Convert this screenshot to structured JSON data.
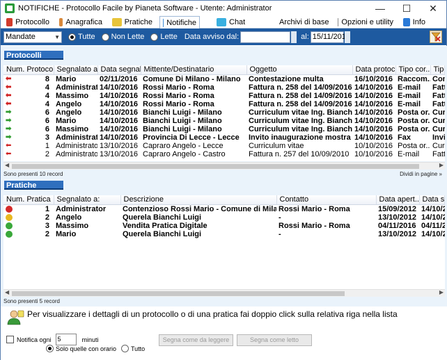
{
  "window": {
    "title": "NOTIFICHE - Protocollo Facile by Pianeta Software - Utente: Administrator"
  },
  "tabs": [
    {
      "label": "Protocollo",
      "icon": "protocollo-icon",
      "color": "#d23b2b"
    },
    {
      "label": "Anagrafica",
      "icon": "anagrafica-icon",
      "color": "#d8883a"
    },
    {
      "label": "Pratiche",
      "icon": "pratiche-icon",
      "color": "#e8c43a"
    },
    {
      "label": "Notifiche",
      "icon": "notifiche-icon",
      "color": "#3a8ad8"
    },
    {
      "label": "Chat",
      "icon": "chat-icon",
      "color": "#3ab0e0"
    },
    {
      "label": "Archivi di base",
      "icon": "archivi-icon",
      "color": "#3a6fd8"
    },
    {
      "label": "Opzioni e utility",
      "icon": "opzioni-icon",
      "color": "#8a8a8a"
    },
    {
      "label": "Info",
      "icon": "info-icon",
      "color": "#2a7ad8"
    }
  ],
  "filter": {
    "type_value": "Mandate",
    "radio_all": "Tutte",
    "radio_unread": "Non Lette",
    "radio_read": "Lette",
    "date_from_label": "Data avviso dal",
    "date_from_value": "",
    "date_to_label": "al",
    "date_to_value": "15/11/2016"
  },
  "protocolli": {
    "title": "Protocolli",
    "columns": [
      "Num. Protoco...",
      "Segnalato a:",
      "Data segnal...",
      "Mittente/Destinatario",
      "Oggetto",
      "Data protoc...",
      "Tipo cor...",
      "Tipo"
    ],
    "rows": [
      {
        "dir": "in",
        "num": "8",
        "segn": "Mario",
        "data": "02/11/2016",
        "mitt": "Comune Di Milano - Milano",
        "ogg": "Contestazione multa",
        "dprot": "16/10/2016",
        "tipo": "Raccom...",
        "tipo2": "Cont",
        "bold": true
      },
      {
        "dir": "in",
        "num": "4",
        "segn": "Administrat...",
        "data": "14/10/2016",
        "mitt": "Rossi Mario - Roma",
        "ogg": "Fattura n. 258 del 14/09/2016",
        "dprot": "14/10/2016",
        "tipo": "E-mail",
        "tipo2": "Fatt",
        "bold": true
      },
      {
        "dir": "in",
        "num": "4",
        "segn": "Massimo",
        "data": "14/10/2016",
        "mitt": "Rossi Mario - Roma",
        "ogg": "Fattura n. 258 del 14/09/2016",
        "dprot": "14/10/2016",
        "tipo": "E-mail",
        "tipo2": "Fatt",
        "bold": true
      },
      {
        "dir": "in",
        "num": "4",
        "segn": "Angelo",
        "data": "14/10/2016",
        "mitt": "Rossi Mario - Roma",
        "ogg": "Fattura n. 258 del 14/09/2016",
        "dprot": "14/10/2016",
        "tipo": "E-mail",
        "tipo2": "Fatt",
        "bold": true
      },
      {
        "dir": "out",
        "num": "6",
        "segn": "Angelo",
        "data": "14/10/2016",
        "mitt": "Bianchi Luigi - Milano",
        "ogg": "Curriculum vitae Ing. Bianchi Luigi",
        "dprot": "14/10/2016",
        "tipo": "Posta or...",
        "tipo2": "Curri",
        "bold": true
      },
      {
        "dir": "out",
        "num": "6",
        "segn": "Mario",
        "data": "14/10/2016",
        "mitt": "Bianchi Luigi - Milano",
        "ogg": "Curriculum vitae Ing. Bianchi Luigi",
        "dprot": "14/10/2016",
        "tipo": "Posta or...",
        "tipo2": "Curri",
        "bold": true
      },
      {
        "dir": "out",
        "num": "6",
        "segn": "Massimo",
        "data": "14/10/2016",
        "mitt": "Bianchi Luigi - Milano",
        "ogg": "Curriculum vitae Ing. Bianchi Luigi",
        "dprot": "14/10/2016",
        "tipo": "Posta or...",
        "tipo2": "Curri",
        "bold": true
      },
      {
        "dir": "out",
        "num": "3",
        "segn": "Administrat...",
        "data": "14/10/2016",
        "mitt": "Provincia Di Lecce - Lecce",
        "ogg": "Invito inaugurazione mostra",
        "dprot": "14/10/2016",
        "tipo": "Fax",
        "tipo2": "Invit",
        "bold": true
      },
      {
        "dir": "in",
        "num": "1",
        "segn": "Administrator",
        "data": "13/10/2016",
        "mitt": "Capraro Angelo - Lecce",
        "ogg": "Curriculum vitae",
        "dprot": "10/10/2016",
        "tipo": "Posta or...",
        "tipo2": "Curri",
        "bold": false
      },
      {
        "dir": "in",
        "num": "2",
        "segn": "Administrator",
        "data": "13/10/2016",
        "mitt": "Capraro Angelo - Castro",
        "ogg": "Fattura n. 257 del 10/09/2010",
        "dprot": "10/10/2016",
        "tipo": "E-mail",
        "tipo2": "Fatt",
        "bold": false
      }
    ],
    "count_text": "Sono presenti 10 record",
    "split_link": "Dividi in pagine »"
  },
  "pratiche": {
    "title": "Pratiche",
    "columns": [
      "Num. Pratica",
      "Segnalato a:",
      "Descrizione",
      "Contatto",
      "Data apert...",
      "Data segn"
    ],
    "rows": [
      {
        "status": "#d42a2a",
        "num": "1",
        "segn": "Administrator",
        "desc": "Contenzioso Rossi Mario - Comune di Milano",
        "cont": "Rossi Mario - Roma",
        "dap": "15/09/2012",
        "dseg": "14/10/201"
      },
      {
        "status": "#e8b820",
        "num": "2",
        "segn": "Angelo",
        "desc": "Querela Bianchi Luigi",
        "cont": "-",
        "dap": "13/10/2012",
        "dseg": "14/10/201"
      },
      {
        "status": "#3aa83a",
        "num": "3",
        "segn": "Massimo",
        "desc": "Vendita Pratica Digitale",
        "cont": "Rossi Mario - Roma",
        "dap": "04/11/2016",
        "dseg": "04/11/201"
      },
      {
        "status": "#3aa83a",
        "num": "2",
        "segn": "Mario",
        "desc": "Querela Bianchi Luigi",
        "cont": "-",
        "dap": "13/10/2012",
        "dseg": "14/10/201"
      }
    ],
    "count_text": "Sono presenti 5 record"
  },
  "hint": "Per visualizzare i dettagli di un protocollo o di una pratica fai doppio click sulla relativa riga nella lista",
  "notify": {
    "label": "Notifica ogni",
    "interval": "5",
    "unit": "minuti",
    "radio_scheduled": "Solo quelle con orario",
    "radio_all": "Tutto",
    "btn_mark_read": "Segna come da leggere",
    "btn_mark_done": "Segna come letto"
  }
}
